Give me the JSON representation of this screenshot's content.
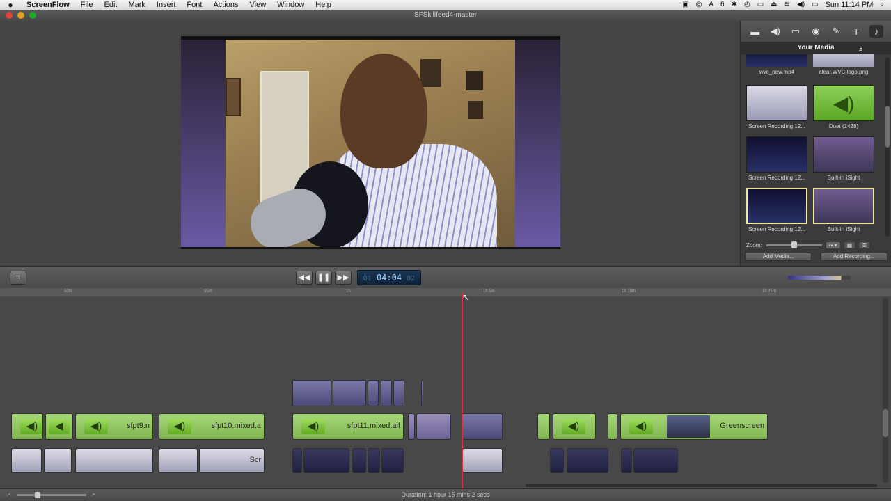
{
  "menubar": {
    "apple_icon": "",
    "app_name": "ScreenFlow",
    "items": [
      "File",
      "Edit",
      "Mark",
      "Insert",
      "Font",
      "Actions",
      "View",
      "Window",
      "Help"
    ],
    "status_number": "6",
    "clock": "Sun 11:14 PM"
  },
  "window": {
    "title": "SFSkillfeed4-master"
  },
  "right_panel": {
    "tabs": [
      "video-icon",
      "audio-icon",
      "screen-icon",
      "callout-icon",
      "annotation-icon",
      "text-icon",
      "media-icon"
    ],
    "header": "Your Media",
    "media": [
      {
        "label": "wvc_new.mp4",
        "kind": "dark"
      },
      {
        "label": "clear.WVC.logo.png",
        "kind": "scr"
      },
      {
        "label": "Screen Recording 12...",
        "kind": "scr"
      },
      {
        "label": "Duet (1428)",
        "kind": "aud"
      },
      {
        "label": "Screen Recording 12...",
        "kind": "dark"
      },
      {
        "label": "Built-in iSight",
        "kind": "cam"
      },
      {
        "label": "Screen Recording 12...",
        "kind": "dark"
      },
      {
        "label": "Built-in iSight",
        "kind": "cam"
      }
    ],
    "zoom_label": "Zoom:",
    "add_media": "Add Media...",
    "add_recording": "Add Recording..."
  },
  "transport": {
    "timecode_hours": "01",
    "timecode_main": "04:04",
    "timecode_frames": "02"
  },
  "ruler": {
    "ticks": [
      "50m",
      "55m",
      "1h",
      "1h 5m",
      "1h 10m",
      "1h 15m"
    ]
  },
  "timeline": {
    "audio_clip_names": [
      "sfpt9.n",
      "sfpt10.mixed.a",
      "sfpt11.mixed.aif",
      "Greenscreen"
    ],
    "screen_clip_label": "Scr",
    "duration": "Duration: 1 hour 15 mins 2 secs"
  },
  "colors": {
    "playhead": "#e0303a",
    "audio_clip": "#8fc45f",
    "timecode_bg": "#1b3552"
  }
}
